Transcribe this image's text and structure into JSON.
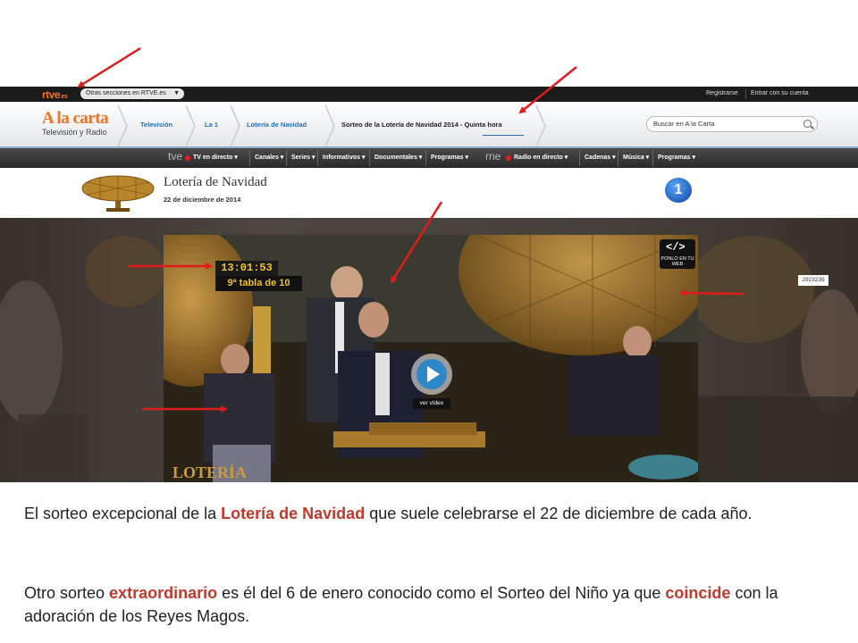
{
  "topbar": {
    "logo": "rtve",
    "logo_suffix": ".es",
    "sections_dropdown": "Otras secciones en RTVE.es",
    "register_link": "Registrarse",
    "login_link": "Entrar con su cuenta"
  },
  "header": {
    "brand_title": "A la carta",
    "brand_subtitle": "Televisión y Radio",
    "breadcrumbs": [
      "Televisión",
      "La 1",
      "Lotería de Navidad"
    ],
    "active_crumb": "Sorteo de la Lotería de Navidad 2014 - Quinta hora",
    "search_placeholder": "Buscar en A la Carta"
  },
  "navbar": {
    "tv_channel": "tve",
    "tv_live": "TV en directo",
    "tv_items": [
      "Canales",
      "Series",
      "Informativos",
      "Documentales",
      "Programas"
    ],
    "radio_channel": "rne",
    "radio_live": "Radio en directo",
    "radio_items": [
      "Cadenas",
      "Música",
      "Programas"
    ]
  },
  "program": {
    "title": "Lotería de Navidad",
    "date": "22 de diciembre de 2014",
    "channel_badge": "1"
  },
  "player": {
    "timer": "13:01:53",
    "table_label": "9ª tabla de 10",
    "embed_icon": "</>",
    "embed_label": "PONLO EN TU WEB",
    "watch_label": "ver vídeo",
    "video_id": "2923239",
    "watermark": "LOTERÍA"
  },
  "caption": {
    "p1_before": "El sorteo excepcional de la ",
    "p1_highlight": "Lotería de Navidad",
    "p1_after": " que suele celebrarse el 22 de diciembre de cada año.",
    "p2_before": "Otro sorteo ",
    "p2_highlight1": "extraordinario",
    "p2_middle": " es él del 6 de enero conocido como el Sorteo del Niño ya que ",
    "p2_highlight2": "coincide",
    "p2_after": " con la adoración de los Reyes Magos."
  },
  "colors": {
    "accent_orange": "#f36f21",
    "link_blue": "#2a6db0",
    "highlight_red": "#c0392b",
    "arrow_red": "#e01b1b",
    "timer_yellow": "#f2c230"
  }
}
